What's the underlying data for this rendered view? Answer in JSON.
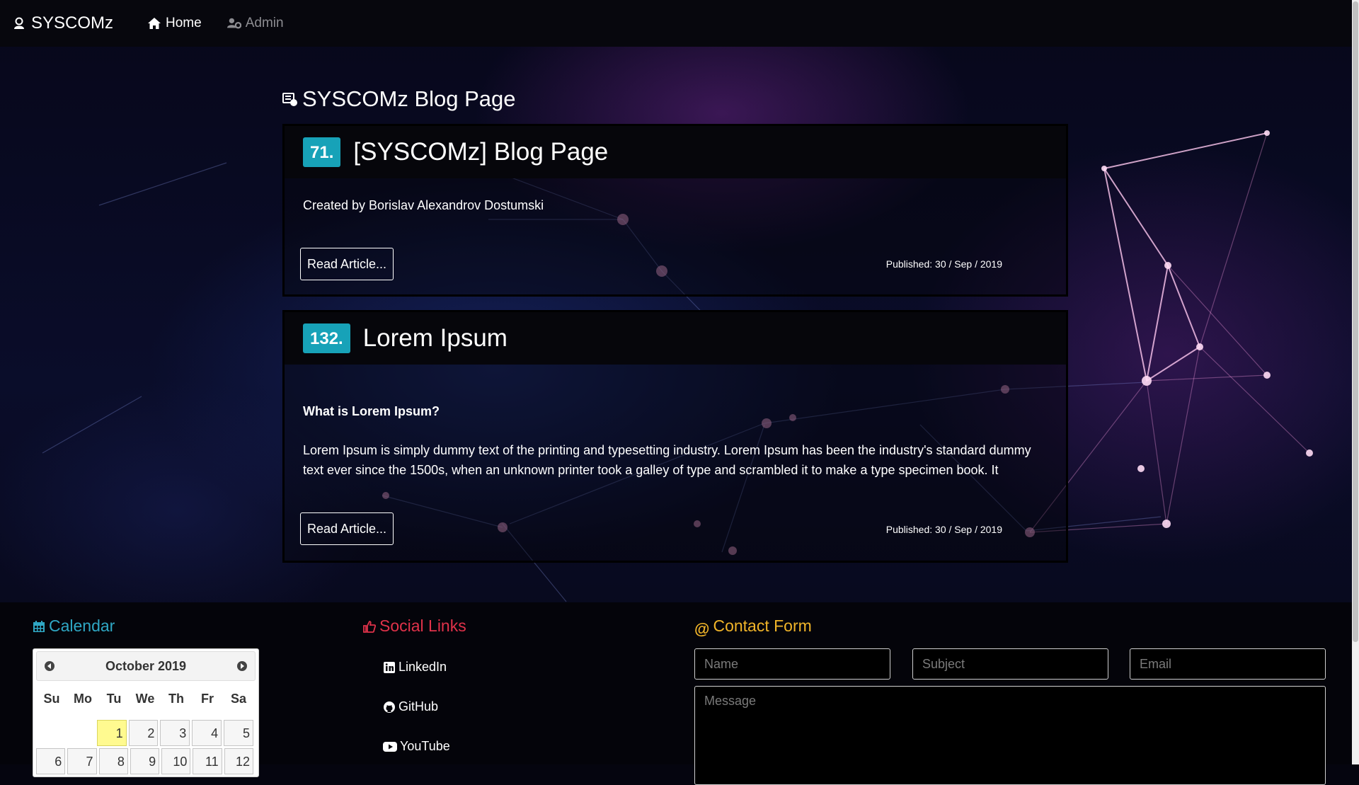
{
  "navbar": {
    "brand": "SYSCOMz",
    "home": "Home",
    "admin": "Admin"
  },
  "main": {
    "heading": "SYSCOMz Blog Page",
    "posts": [
      {
        "number": "71.",
        "title": "[SYSCOMz] Blog Page",
        "text": "Created by Borislav Alexandrov Dostumski",
        "button": "Read Article...",
        "published": "Published: 30 / Sep / 2019"
      },
      {
        "number": "132.",
        "title": "Lorem Ipsum",
        "subtitle": "What is Lorem Ipsum?",
        "text": "Lorem Ipsum is simply dummy text of the printing and typesetting industry. Lorem Ipsum has been the industry's standard dummy text ever since the 1500s, when an unknown printer took a galley of type and scrambled it to make a type specimen book. It",
        "button": "Read Article...",
        "published": "Published: 30 / Sep / 2019"
      }
    ]
  },
  "footer": {
    "calendar": {
      "title": "Calendar",
      "month": "October 2019",
      "weekdays": [
        "Su",
        "Mo",
        "Tu",
        "We",
        "Th",
        "Fr",
        "Sa"
      ],
      "weeks": [
        [
          "",
          "",
          "1",
          "2",
          "3",
          "4",
          "5"
        ],
        [
          "6",
          "7",
          "8",
          "9",
          "10",
          "11",
          "12"
        ]
      ],
      "today": "1"
    },
    "social": {
      "title": "Social Links",
      "links": [
        "LinkedIn",
        "GitHub",
        "YouTube"
      ]
    },
    "contact": {
      "title": "Contact Form",
      "name_placeholder": "Name",
      "subject_placeholder": "Subject",
      "email_placeholder": "Email",
      "message_placeholder": "Message"
    }
  },
  "colors": {
    "badge": "#17a2b8",
    "calendar_title": "#2fa7c4",
    "social_title": "#e0324a",
    "contact_title": "#f0b429",
    "today_highlight": "#fffa90"
  }
}
